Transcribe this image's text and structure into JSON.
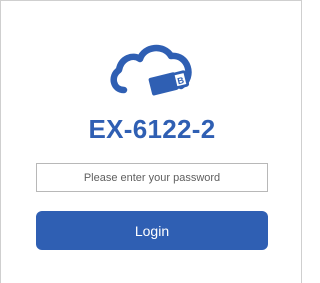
{
  "colors": {
    "brand_blue": "#2f5fb3",
    "border": "#cfcfcf",
    "input_border": "#b8b8b8"
  },
  "logo": {
    "icon": "cloud-usb-icon"
  },
  "header": {
    "device_name": "EX-6122-2"
  },
  "login_form": {
    "password_value": "",
    "password_placeholder": "Please enter your password",
    "login_label": "Login"
  }
}
